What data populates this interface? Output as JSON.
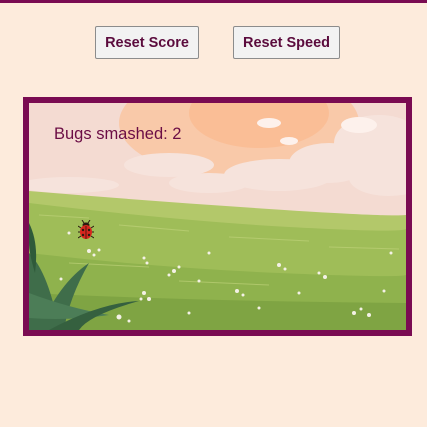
{
  "controls": {
    "reset_score_label": "Reset Score",
    "reset_speed_label": "Reset Speed"
  },
  "game": {
    "score_text": "Bugs smashed: 2",
    "bugs_smashed": 2,
    "bug_icon": "ladybug-icon"
  },
  "colors": {
    "accent": "#7A0B52",
    "background": "#FDEBDC",
    "button_text": "#5B0B3D"
  }
}
